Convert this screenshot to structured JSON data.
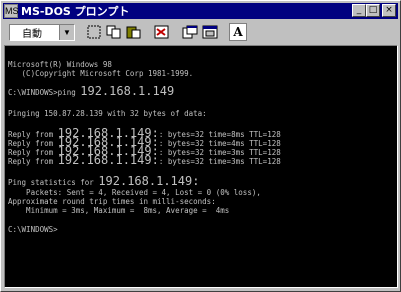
{
  "window": {
    "title": "MS-DOS プロンプト",
    "icon_label": "MS",
    "minimize_glyph": "_",
    "maximize_glyph": "□",
    "close_glyph": "×"
  },
  "toolbar": {
    "font_value": "自動",
    "dropdown_glyph": "▼",
    "text_button_glyph": "A"
  },
  "console": {
    "lines": [
      "Microsoft(R) Windows 98",
      "   (C)Copyright Microsoft Corp 1981-1999.",
      "C:\\WINDOWS>ping ",
      "Pinging 150.87.28.139 with 32 bytes of data:",
      "Reply from ",
      ": bytes=32 time=8ms TTL=128",
      ": bytes=32 time=4ms TTL=128",
      ": bytes=32 time=3ms TTL=128",
      ": bytes=32 time=3ms TTL=128",
      "Ping statistics for ",
      "    Packets: Sent = 4, Received = 4, Lost = 0 (0% loss),",
      "Approximate round trip times in milli-seconds:",
      "    Minimum = 3ms, Maximum =  8ms, Average =  4ms",
      "C:\\WINDOWS>"
    ],
    "ip": "192.168.1.149",
    "ip_colon": "192.168.1.149:"
  }
}
